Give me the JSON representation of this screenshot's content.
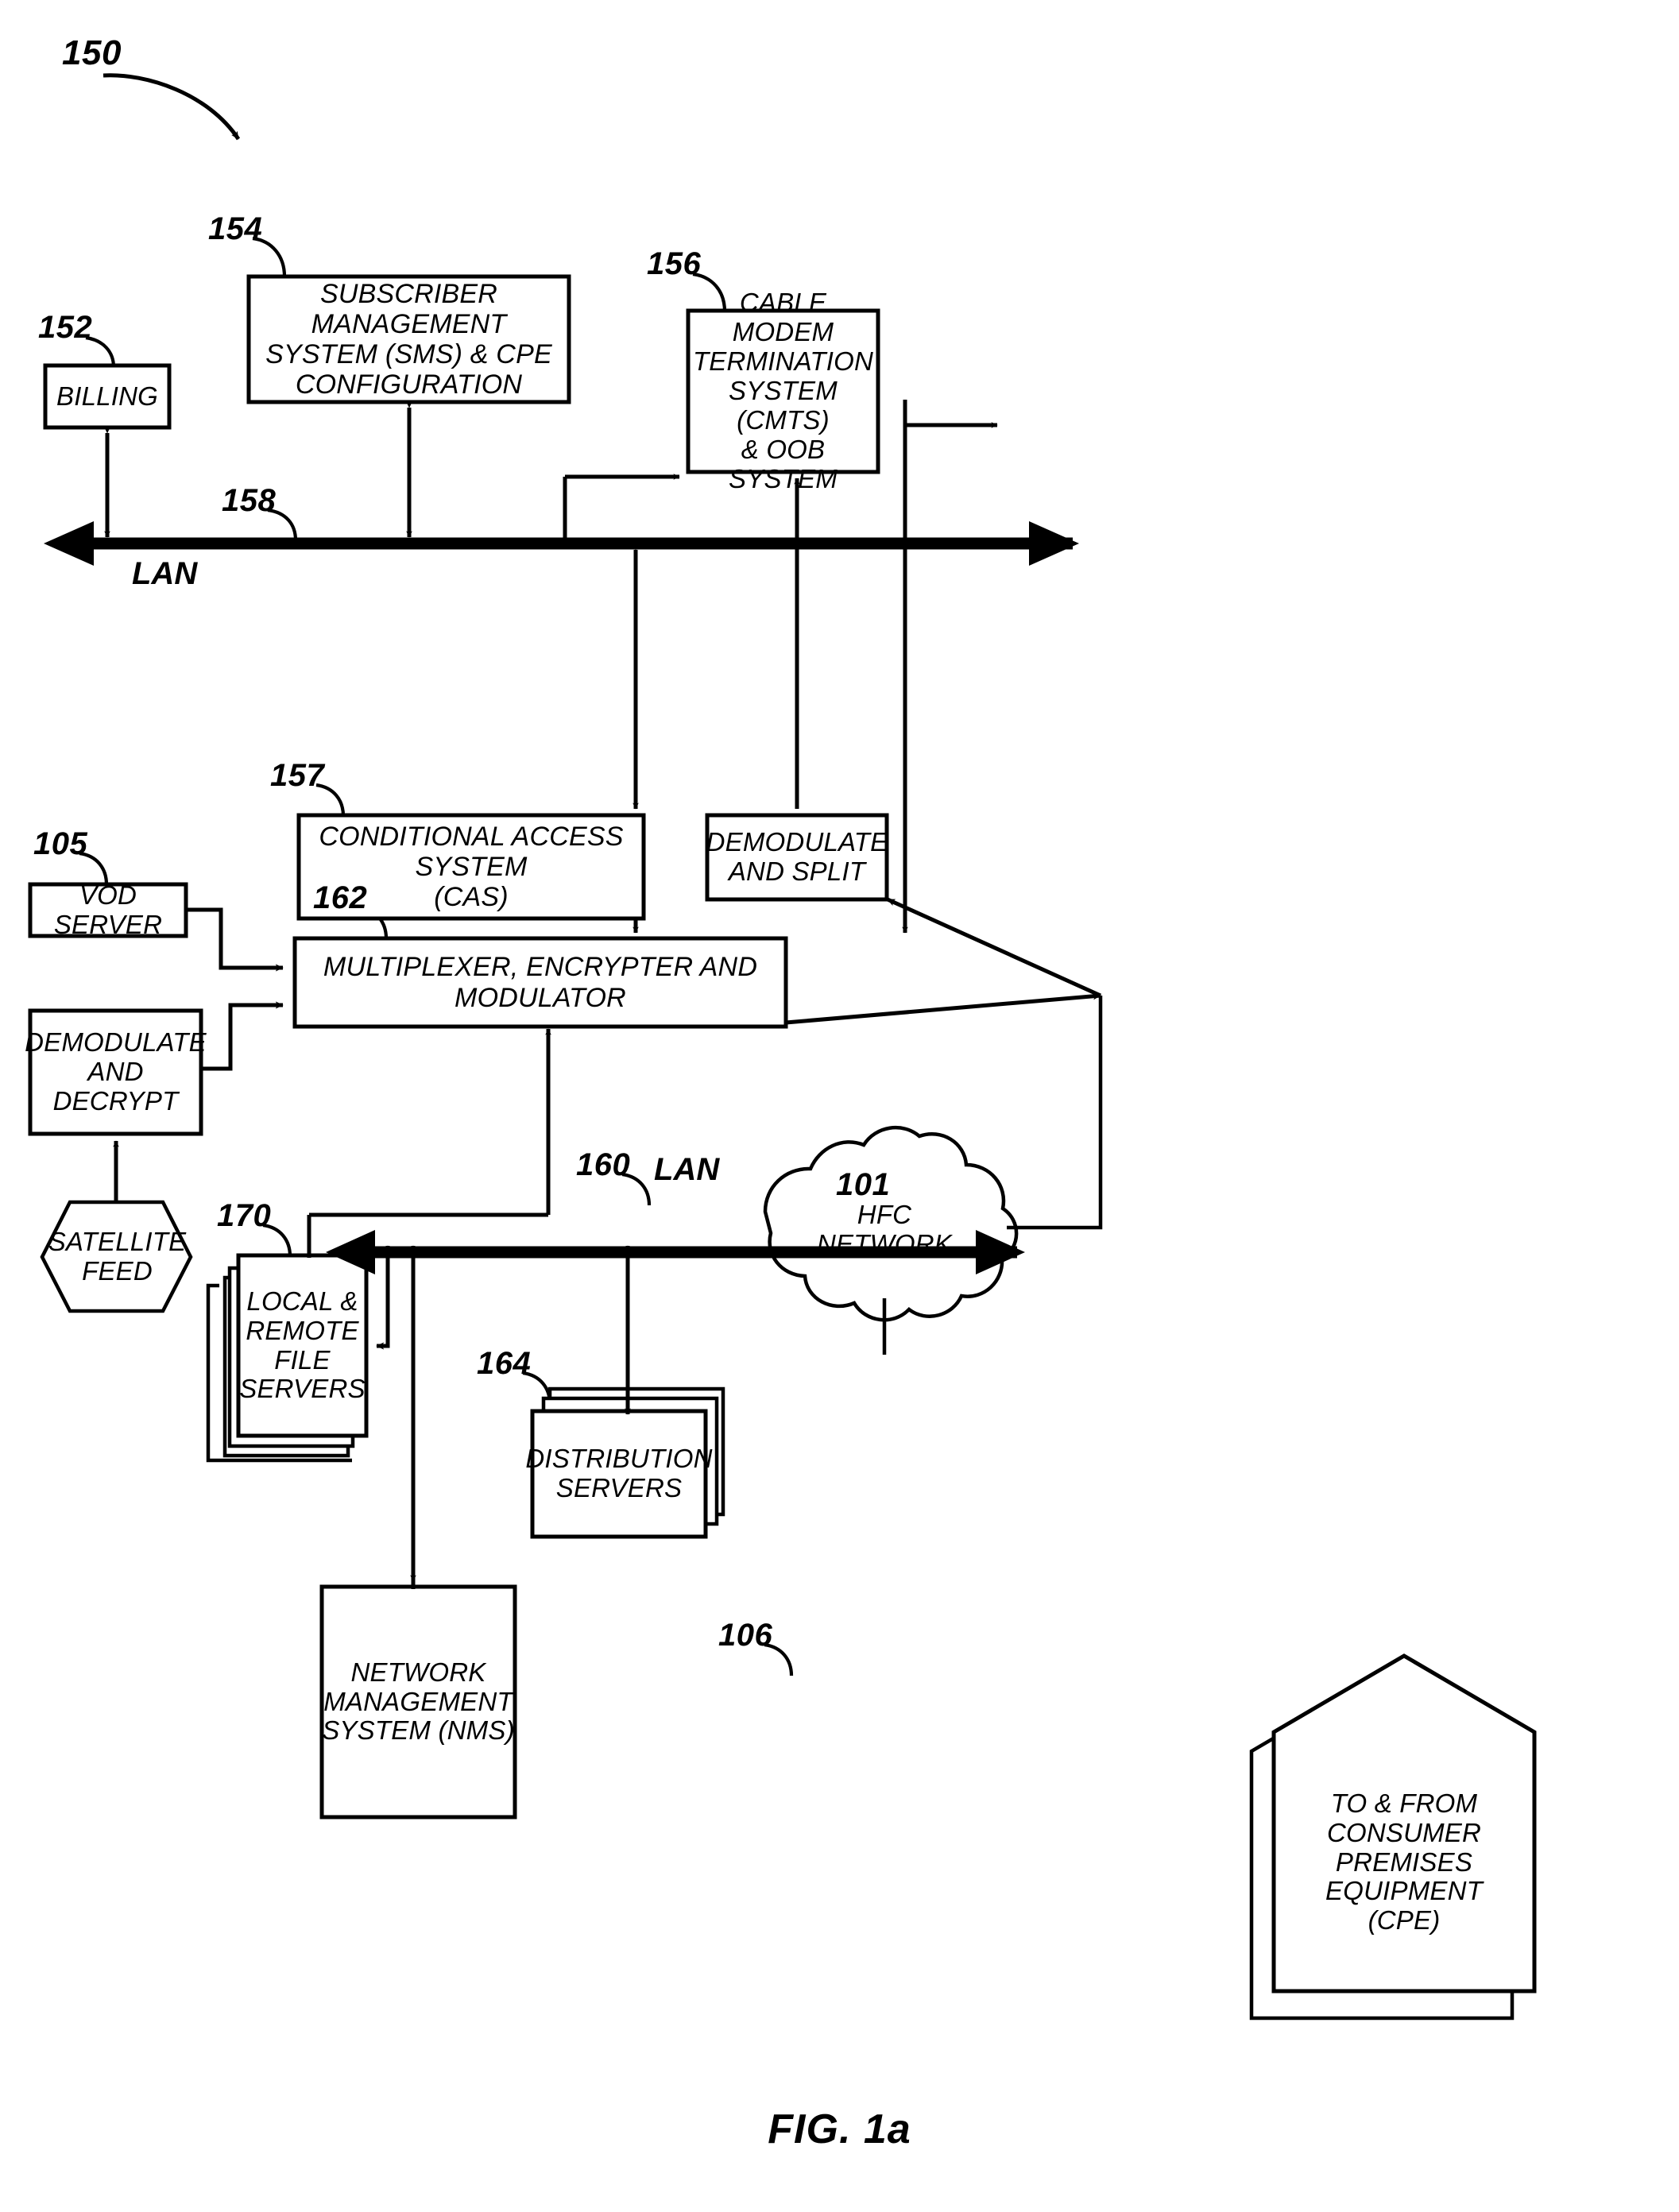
{
  "figure": {
    "caption": "FIG. 1a",
    "system_ref": "150"
  },
  "nodes": {
    "billing": {
      "ref": "152",
      "label": "BILLING"
    },
    "sms": {
      "ref": "154",
      "label": "SUBSCRIBER MANAGEMENT\nSYSTEM (SMS) & CPE\nCONFIGURATION"
    },
    "cmts": {
      "ref": "156",
      "label": "CABLE MODEM\nTERMINATION\nSYSTEM (CMTS)\n& OOB SYSTEM"
    },
    "cas": {
      "ref": "157",
      "label": "CONDITIONAL ACCESS SYSTEM\n(CAS)"
    },
    "demod_split": {
      "ref": "",
      "label": "DEMODULATE\nAND SPLIT"
    },
    "vod": {
      "ref": "105",
      "label": "VOD SERVER"
    },
    "demod_decrypt": {
      "ref": "",
      "label": "DEMODULATE\nAND DECRYPT"
    },
    "mux": {
      "ref": "162",
      "label": "MULTIPLEXER, ENCRYPTER AND MODULATOR"
    },
    "satellite": {
      "ref": "",
      "label": "SATELLITE\nFEED"
    },
    "file_servers": {
      "ref": "170",
      "label": "LOCAL &\nREMOTE\nFILE\nSERVERS"
    },
    "dist_servers": {
      "ref": "164",
      "label": "DISTRIBUTION\nSERVERS"
    },
    "nms": {
      "ref": "",
      "label": "NETWORK\nMANAGEMENT\nSYSTEM (NMS)"
    },
    "hfc": {
      "ref": "101",
      "label": "HFC\nNETWORK"
    },
    "cpe": {
      "ref": "106",
      "label": "TO & FROM\nCONSUMER\nPREMISES\nEQUIPMENT\n(CPE)"
    }
  },
  "buses": {
    "upper_lan": {
      "ref": "158",
      "label": "LAN"
    },
    "lower_lan": {
      "ref": "160",
      "label": "LAN"
    }
  },
  "colors": {
    "stroke": "#000000",
    "background": "#ffffff"
  }
}
